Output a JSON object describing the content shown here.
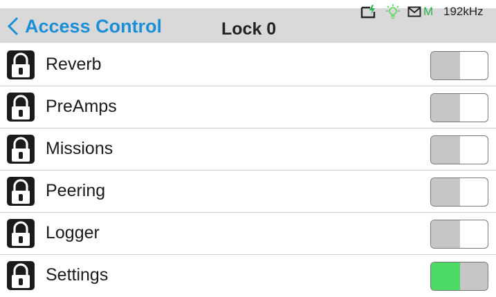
{
  "header": {
    "back_label": "Access Control",
    "title": "Lock 0",
    "status": {
      "battery_icon": "battery-charging-icon",
      "bulb_icon": "lightbulb-icon",
      "mail_icon": "mail-icon",
      "mode": "M",
      "sample_rate": "192kHz"
    }
  },
  "colors": {
    "accent": "#1a8fd8",
    "header_bg": "#d9d9d9",
    "toggle_on": "#4cd964",
    "toggle_off": "#c6c6c6",
    "status_green": "#29b04a"
  },
  "items": [
    {
      "label": "Reverb",
      "icon": "lock-icon",
      "enabled": false
    },
    {
      "label": "PreAmps",
      "icon": "lock-icon",
      "enabled": false
    },
    {
      "label": "Missions",
      "icon": "lock-icon",
      "enabled": false
    },
    {
      "label": "Peering",
      "icon": "lock-icon",
      "enabled": false
    },
    {
      "label": "Logger",
      "icon": "lock-icon",
      "enabled": false
    },
    {
      "label": "Settings",
      "icon": "lock-icon",
      "enabled": true
    }
  ]
}
